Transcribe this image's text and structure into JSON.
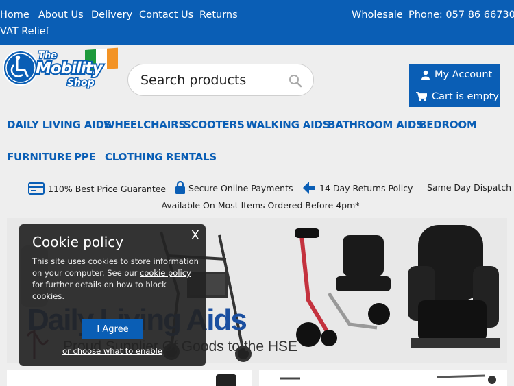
{
  "topbar": {
    "links": [
      "Home",
      "About Us",
      "Delivery",
      "Contact Us",
      "Returns"
    ],
    "vat": "VAT Relief",
    "wholesale": "Wholesale",
    "phone": "Phone: 057 86 66730"
  },
  "header": {
    "logo_text": [
      "The",
      "Mobility",
      "Shop"
    ],
    "search_placeholder": "Search products",
    "account": "My Account",
    "cart": "Cart is empty"
  },
  "nav": [
    "DAILY LIVING AIDS",
    "WHEELCHAIRS",
    "SCOOTERS",
    "WALKING AIDS",
    "BATHROOM AIDS",
    "BEDROOM",
    "FURNITURE",
    "PPE",
    "CLOTHING",
    "RENTALS"
  ],
  "usp": {
    "price": "110% Best Price Guarantee",
    "secure": "Secure Online Payments",
    "returns": "14 Day Returns Policy",
    "dispatch": "Same Day Dispatch",
    "dispatch_note": "Available On Most Items Ordered Before 4pm*"
  },
  "banner": {
    "headline": "Daily Living Aids",
    "subline": "Proud Supplier Of Goods to the HSE"
  },
  "cookie": {
    "close": "X",
    "title": "Cookie policy",
    "text_before": "This site uses cookies to store information on your computer. See our ",
    "link": "cookie policy",
    "text_after": " for further details on how to block cookies.",
    "agree": "I Agree",
    "choose": "or choose what to enable"
  },
  "colors": {
    "brand_blue": "#0a5eb5"
  }
}
